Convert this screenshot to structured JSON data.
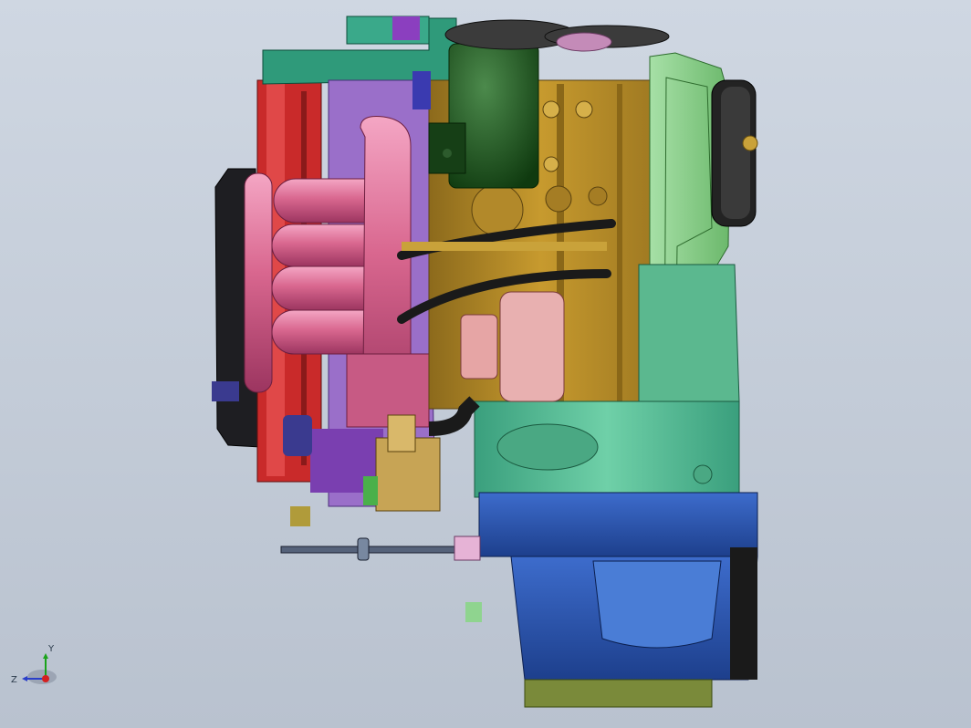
{
  "view": {
    "background_top": "#cfd7e2",
    "background_bottom": "#b9c2cf"
  },
  "model": {
    "description_colors": {
      "intake_manifold": "#d9678f",
      "block": "#c79a2e",
      "gearbox_top": "#5fbf9a",
      "oil_pan": "#2f5fb8",
      "head_cover": "#2f9a7a",
      "radiator": "#cc2a2a",
      "belt_cover": "#8fd48f",
      "fan_shroud": "#222222"
    }
  },
  "triad": {
    "y_label": "Y",
    "z_label": "Z",
    "y_color": "#1aa31a",
    "z_color": "#2a3fc9",
    "x_color": "#d42020"
  }
}
